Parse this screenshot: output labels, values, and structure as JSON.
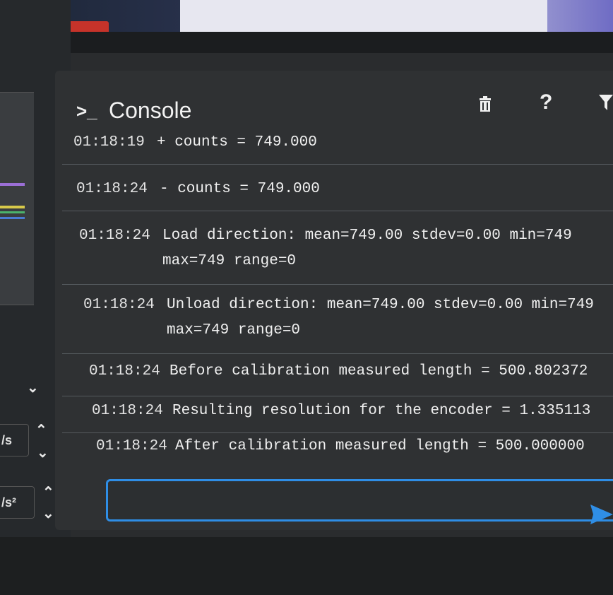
{
  "console": {
    "title": "Console",
    "icons": [
      "prompt-icon",
      "trash-icon",
      "help-icon",
      "filter-icon",
      "send-icon"
    ],
    "help_label": "?",
    "entries": [
      {
        "time": "01:18:19",
        "message": "+ counts = 749.000",
        "message_line2": ""
      },
      {
        "time": "01:18:24",
        "message": "- counts = 749.000",
        "message_line2": ""
      },
      {
        "time": "01:18:24",
        "message": "Load direction: mean=749.00 stdev=0.00 min=749",
        "message_line2": "max=749 range=0"
      },
      {
        "time": "01:18:24",
        "message": "Unload direction: mean=749.00 stdev=0.00 min=749",
        "message_line2": "max=749 range=0"
      },
      {
        "time": "01:18:24",
        "message": "Before calibration measured length = 500.802372",
        "message_line2": ""
      },
      {
        "time": "01:18:24",
        "message": "Resulting resolution for the encoder = 1.335113",
        "message_line2": ""
      },
      {
        "time": "01:18:24",
        "message": "After calibration measured length = 500.000000",
        "message_line2": ""
      }
    ],
    "input": {
      "value": "",
      "placeholder": ""
    }
  },
  "left_panel": {
    "field_1_unit": "/s",
    "field_2_unit": "/s²"
  },
  "colors": {
    "input_border": "#2f8ee6",
    "send_arrow": "#2f8ee6",
    "panel_bg": "#2f3133"
  }
}
